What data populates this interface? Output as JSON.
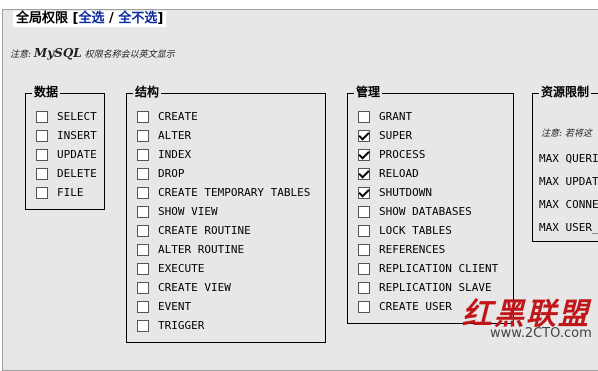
{
  "header": {
    "title": "全局权限",
    "bracket_open": "[",
    "select_all": "全选",
    "separator": " / ",
    "select_none": "全不选",
    "bracket_close": "]"
  },
  "note": {
    "prefix": "注意:",
    "mysql": "MySQL",
    "text": "权限名称会以英文显示"
  },
  "groups": {
    "data": {
      "title": "数据",
      "items": [
        {
          "label": "SELECT",
          "checked": false
        },
        {
          "label": "INSERT",
          "checked": false
        },
        {
          "label": "UPDATE",
          "checked": false
        },
        {
          "label": "DELETE",
          "checked": false
        },
        {
          "label": "FILE",
          "checked": false
        }
      ]
    },
    "structure": {
      "title": "结构",
      "items": [
        {
          "label": "CREATE",
          "checked": false
        },
        {
          "label": "ALTER",
          "checked": false
        },
        {
          "label": "INDEX",
          "checked": false
        },
        {
          "label": "DROP",
          "checked": false
        },
        {
          "label": "CREATE TEMPORARY TABLES",
          "checked": false
        },
        {
          "label": "SHOW VIEW",
          "checked": false
        },
        {
          "label": "CREATE ROUTINE",
          "checked": false
        },
        {
          "label": "ALTER ROUTINE",
          "checked": false
        },
        {
          "label": "EXECUTE",
          "checked": false
        },
        {
          "label": "CREATE VIEW",
          "checked": false
        },
        {
          "label": "EVENT",
          "checked": false
        },
        {
          "label": "TRIGGER",
          "checked": false
        }
      ]
    },
    "admin": {
      "title": "管理",
      "items": [
        {
          "label": "GRANT",
          "checked": false
        },
        {
          "label": "SUPER",
          "checked": true
        },
        {
          "label": "PROCESS",
          "checked": true
        },
        {
          "label": "RELOAD",
          "checked": true
        },
        {
          "label": "SHUTDOWN",
          "checked": true
        },
        {
          "label": "SHOW DATABASES",
          "checked": false
        },
        {
          "label": "LOCK TABLES",
          "checked": false
        },
        {
          "label": "REFERENCES",
          "checked": false
        },
        {
          "label": "REPLICATION CLIENT",
          "checked": false
        },
        {
          "label": "REPLICATION SLAVE",
          "checked": false
        },
        {
          "label": "CREATE USER",
          "checked": false
        }
      ]
    },
    "limits": {
      "title": "资源限制",
      "note": "注意: 若将这",
      "items": [
        "MAX QUERI",
        "MAX UPDAT",
        "MAX CONNE",
        "MAX USER_"
      ]
    }
  },
  "watermark": {
    "brand": "红黑联盟",
    "url": "www.2CTO.com"
  }
}
